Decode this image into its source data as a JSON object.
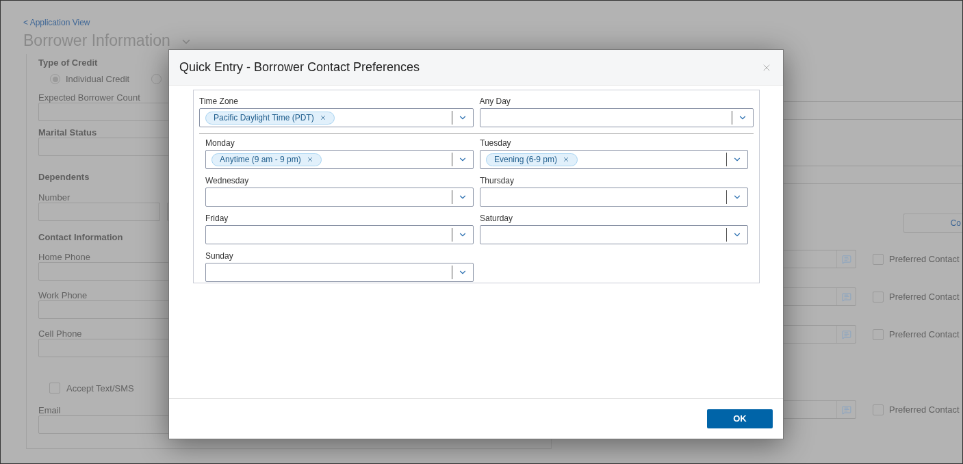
{
  "page": {
    "back_link": "< Application View",
    "title": "Borrower Information",
    "left_panel": {
      "type_of_credit": {
        "label": "Type of Credit",
        "options": [
          {
            "label": "Individual Credit",
            "selected": true
          },
          {
            "selected": false
          }
        ]
      },
      "expected_borrower_count": {
        "label": "Expected Borrower Count"
      },
      "marital_status": {
        "label": "Marital Status"
      },
      "dependents": {
        "heading": "Dependents",
        "number_label": "Number"
      },
      "contact_information": {
        "heading": "Contact Information",
        "fields": [
          {
            "label": "Home Phone"
          },
          {
            "label": "Work Phone"
          },
          {
            "label": "Cell Phone"
          }
        ],
        "accept_text_sms": {
          "label": "Accept Text/SMS",
          "checked": false
        },
        "email": {
          "label": "Email"
        }
      }
    },
    "right_panel": {
      "copy_button": "Co",
      "contact_rows": [
        {
          "preferred_label": "Preferred Contact",
          "checked": false
        },
        {
          "preferred_label": "Preferred Contact",
          "checked": false
        },
        {
          "preferred_label": "Preferred Contact",
          "checked": false
        },
        {
          "preferred_label": "Preferred Contact",
          "checked": false
        }
      ]
    }
  },
  "dialog": {
    "title": "Quick Entry - Borrower Contact Preferences",
    "time_zone": {
      "label": "Time Zone",
      "values": [
        "Pacific Daylight Time (PDT)"
      ]
    },
    "any_day": {
      "label": "Any Day"
    },
    "days": [
      {
        "label": "Monday",
        "values": [
          "Anytime (9 am - 9 pm)"
        ]
      },
      {
        "label": "Tuesday",
        "values": [
          "Evening (6-9 pm)"
        ]
      },
      {
        "label": "Wednesday"
      },
      {
        "label": "Thursday"
      },
      {
        "label": "Friday"
      },
      {
        "label": "Saturday"
      },
      {
        "label": "Sunday"
      }
    ],
    "ok_button": "OK"
  }
}
